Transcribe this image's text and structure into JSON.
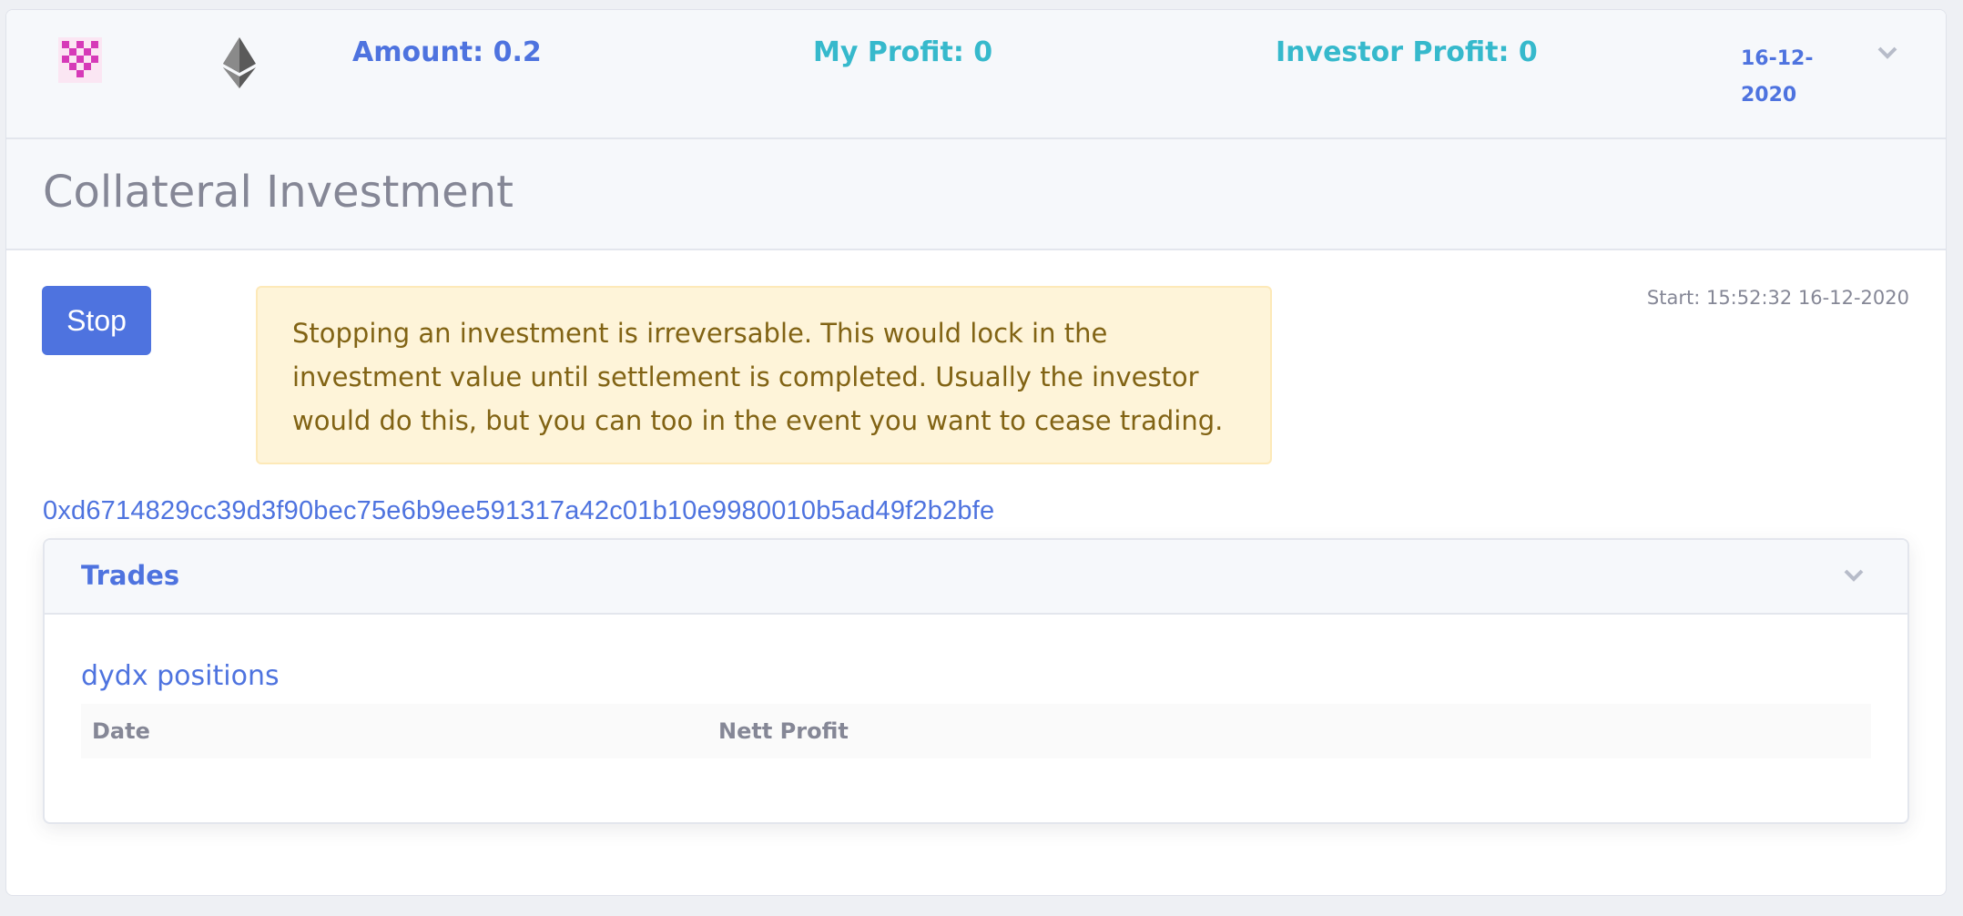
{
  "summary": {
    "logo_icon": "pink-checker-token-icon",
    "asset_icon": "ethereum-icon",
    "amount": "Amount: 0.2",
    "my_profit": "My Profit: 0",
    "investor_profit": "Investor Profit: 0",
    "date": "16-12-2020",
    "expand_icon": "chevron-down-icon"
  },
  "investment": {
    "title": "Collateral Investment",
    "stop_label": "Stop",
    "warning": "Stopping an investment is irreversable. This would lock in the investment value until settlement is completed. Usually the investor would do this, but you can too in the event you want to cease trading.",
    "start": "Start: 15:52:32 16-12-2020",
    "tx_hash": "0xd6714829cc39d3f90bec75e6b9ee591317a42c01b10e9980010b5ad49f2b2bfe"
  },
  "trades": {
    "title": "Trades",
    "positions_title": "dydx positions",
    "columns": [
      "Date",
      "Nett Profit"
    ],
    "rows": []
  },
  "colors": {
    "primary": "#4e73df",
    "info": "#36b9cc",
    "warning_bg": "#fef4d9",
    "warning_text": "#816314",
    "muted": "#858796"
  }
}
